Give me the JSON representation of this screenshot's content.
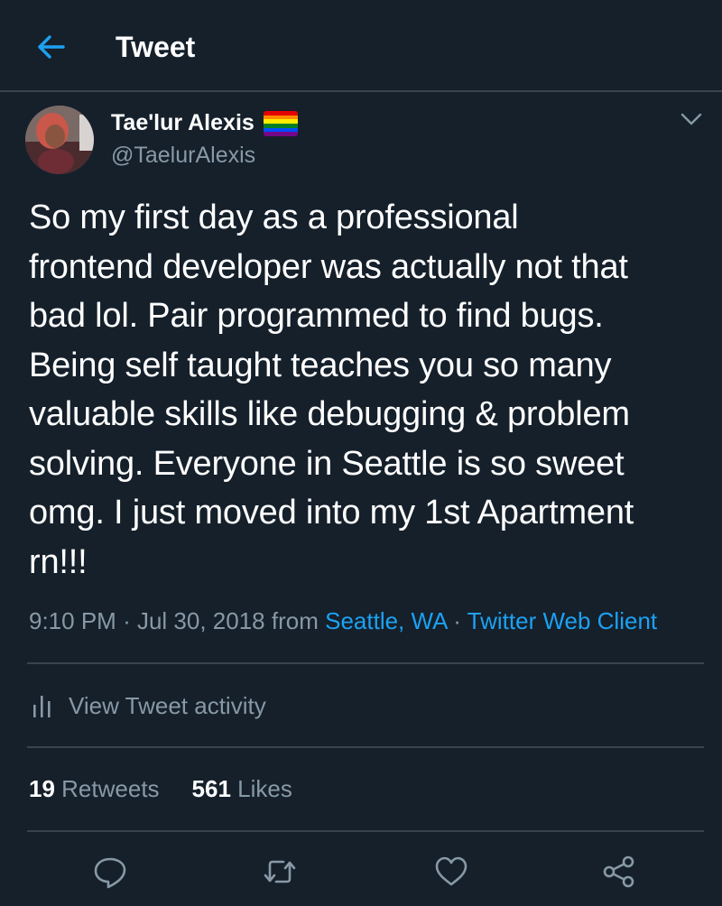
{
  "header": {
    "title": "Tweet",
    "back_icon": "arrow-left-icon"
  },
  "author": {
    "name": "Tae'lur Alexis",
    "handle": "@TaelurAlexis",
    "badge": "rainbow-flag-icon",
    "flag_colors": [
      "#e40303",
      "#ff8c00",
      "#ffed00",
      "#008026",
      "#004dff",
      "#750787"
    ]
  },
  "tweet": {
    "lines": [
      "So my first day as a professional",
      "frontend developer was actually not that",
      "bad lol. Pair programmed to find bugs.",
      "Being self taught teaches you so many",
      "valuable skills like debugging & problem",
      "solving. Everyone in Seattle is so sweet",
      "omg. I just moved into my 1st Apartment",
      "rn!!!"
    ]
  },
  "meta": {
    "time": "9:10 PM",
    "sep1": "·",
    "date": "Jul 30, 2018",
    "from": "from",
    "location": "Seattle, WA",
    "sep2": "·",
    "client": "Twitter Web Client"
  },
  "activity": {
    "label": "View Tweet activity",
    "icon": "bar-chart-icon"
  },
  "stats": {
    "retweets_count": "19",
    "retweets_label": "Retweets",
    "likes_count": "561",
    "likes_label": "Likes"
  },
  "actions": [
    "reply-icon",
    "retweet-icon",
    "like-icon",
    "share-icon"
  ],
  "colors": {
    "background": "#15202b",
    "accent": "#1da1f2",
    "muted": "#8899a6",
    "divider": "#38444d"
  }
}
